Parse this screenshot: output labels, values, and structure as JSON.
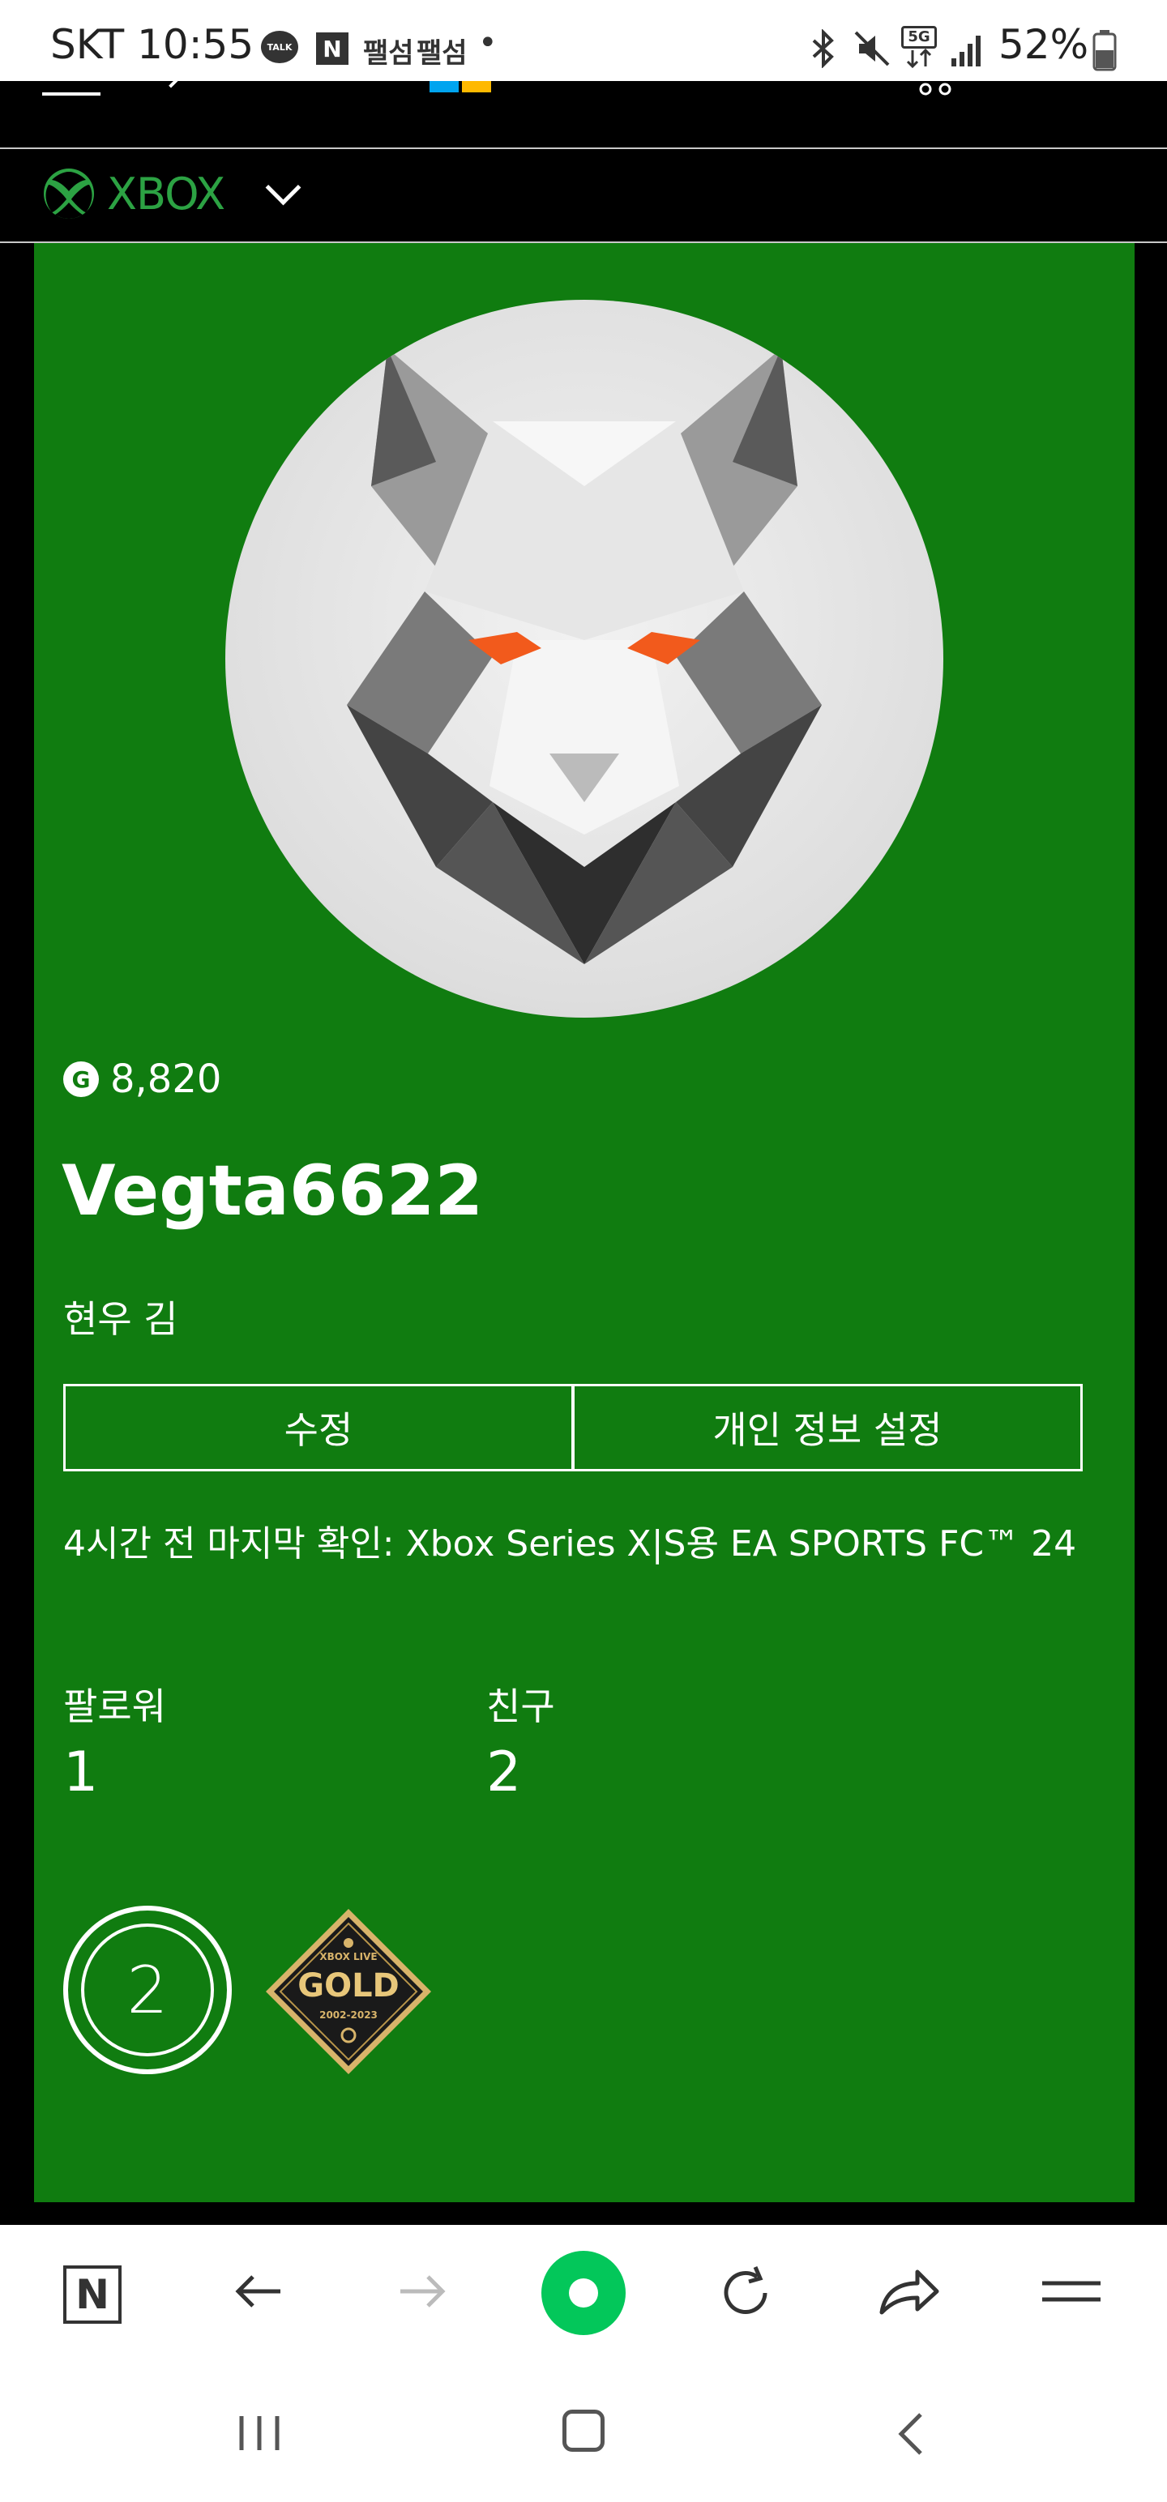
{
  "status_bar": {
    "carrier_time": "SKT 10:55",
    "notif_talk": "TALK",
    "notif_naver": "N",
    "notif_app1": "팰섬",
    "notif_app2": "팰섬",
    "notif_dot": "•",
    "network": "5G",
    "battery": "52%"
  },
  "xbox_header": {
    "brand": "XBOX"
  },
  "profile": {
    "gamerscore": "8,820",
    "gamertag": "Vegta6622",
    "real_name": "현우 김",
    "edit_label": "수정",
    "privacy_label": "개인 정보 설정",
    "last_seen": "4시간 전 마지막 확인: Xbox Series X|S용 EA SPORTS FC™ 24",
    "followers_label": "팔로워",
    "followers_count": "1",
    "friends_label": "친구",
    "friends_count": "2",
    "level_badge": "2",
    "gold_badge": {
      "top": "XBOX LIVE",
      "main": "GOLD",
      "years": "2002-2023"
    }
  },
  "colors": {
    "xbox_green": "#107c10",
    "brand_green": "#2ca243"
  }
}
